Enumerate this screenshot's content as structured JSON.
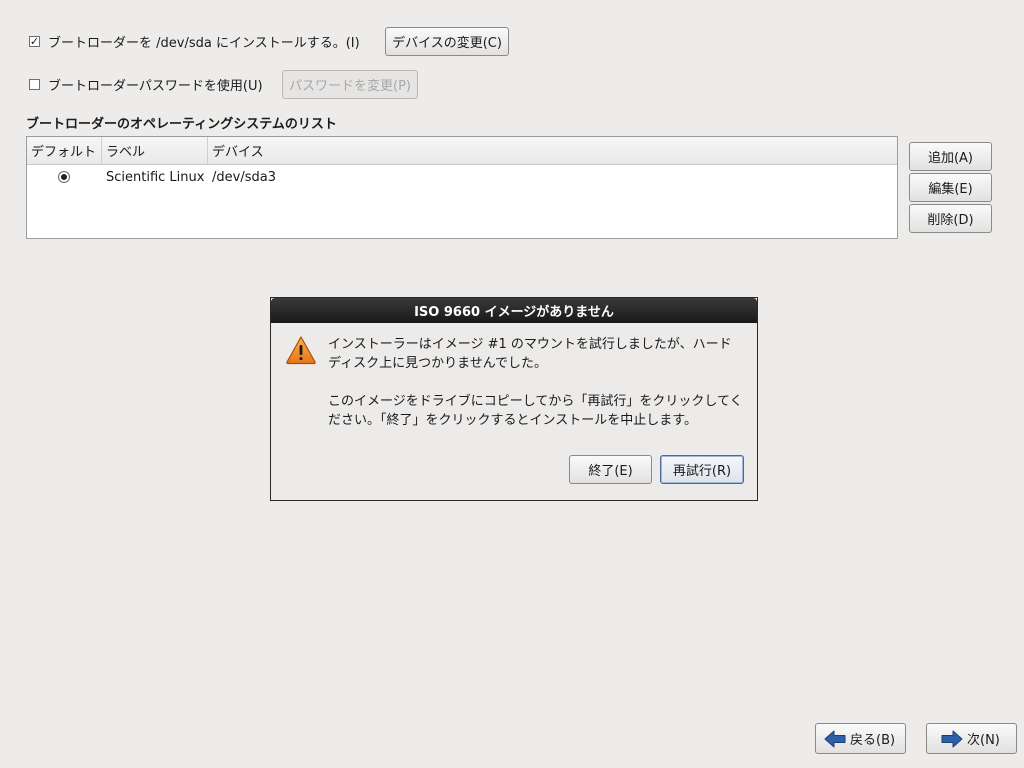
{
  "bootloader": {
    "install_label": "ブートローダーを /dev/sda にインストールする。(I)",
    "install_checked": true,
    "change_device_button": "デバイスの変更(C)",
    "password_label": "ブートローダーパスワードを使用(U)",
    "password_checked": false,
    "change_password_button": "パスワードを変更(P)"
  },
  "os_list": {
    "heading": "ブートローダーのオペレーティングシステムのリスト",
    "columns": [
      "デフォルト",
      "ラベル",
      "デバイス"
    ],
    "rows": [
      {
        "default": true,
        "label": "Scientific Linux",
        "device": "/dev/sda3"
      }
    ],
    "add_button": "追加(A)",
    "edit_button": "編集(E)",
    "delete_button": "削除(D)"
  },
  "dialog": {
    "title": "ISO 9660 イメージがありません",
    "icon": "warning-icon",
    "message_line1": "インストーラーはイメージ #1 のマウントを試行しましたが、ハード",
    "message_line2": "ディスク上に見つかりませんでした。",
    "message_line3": "このイメージをドライブにコピーしてから「再試行」をクリックしてく",
    "message_line4": "ださい。「終了」をクリックするとインストールを中止します。",
    "exit_button": "終了(E)",
    "retry_button": "再試行(R)"
  },
  "nav": {
    "back_button": "戻る(B)",
    "next_button": "次(N)"
  },
  "colors": {
    "background": "#edeceb",
    "dialog_title_bg": "#1f1f1f",
    "warning": "#f08a1c",
    "nav_arrow": "#2f5fa8"
  }
}
